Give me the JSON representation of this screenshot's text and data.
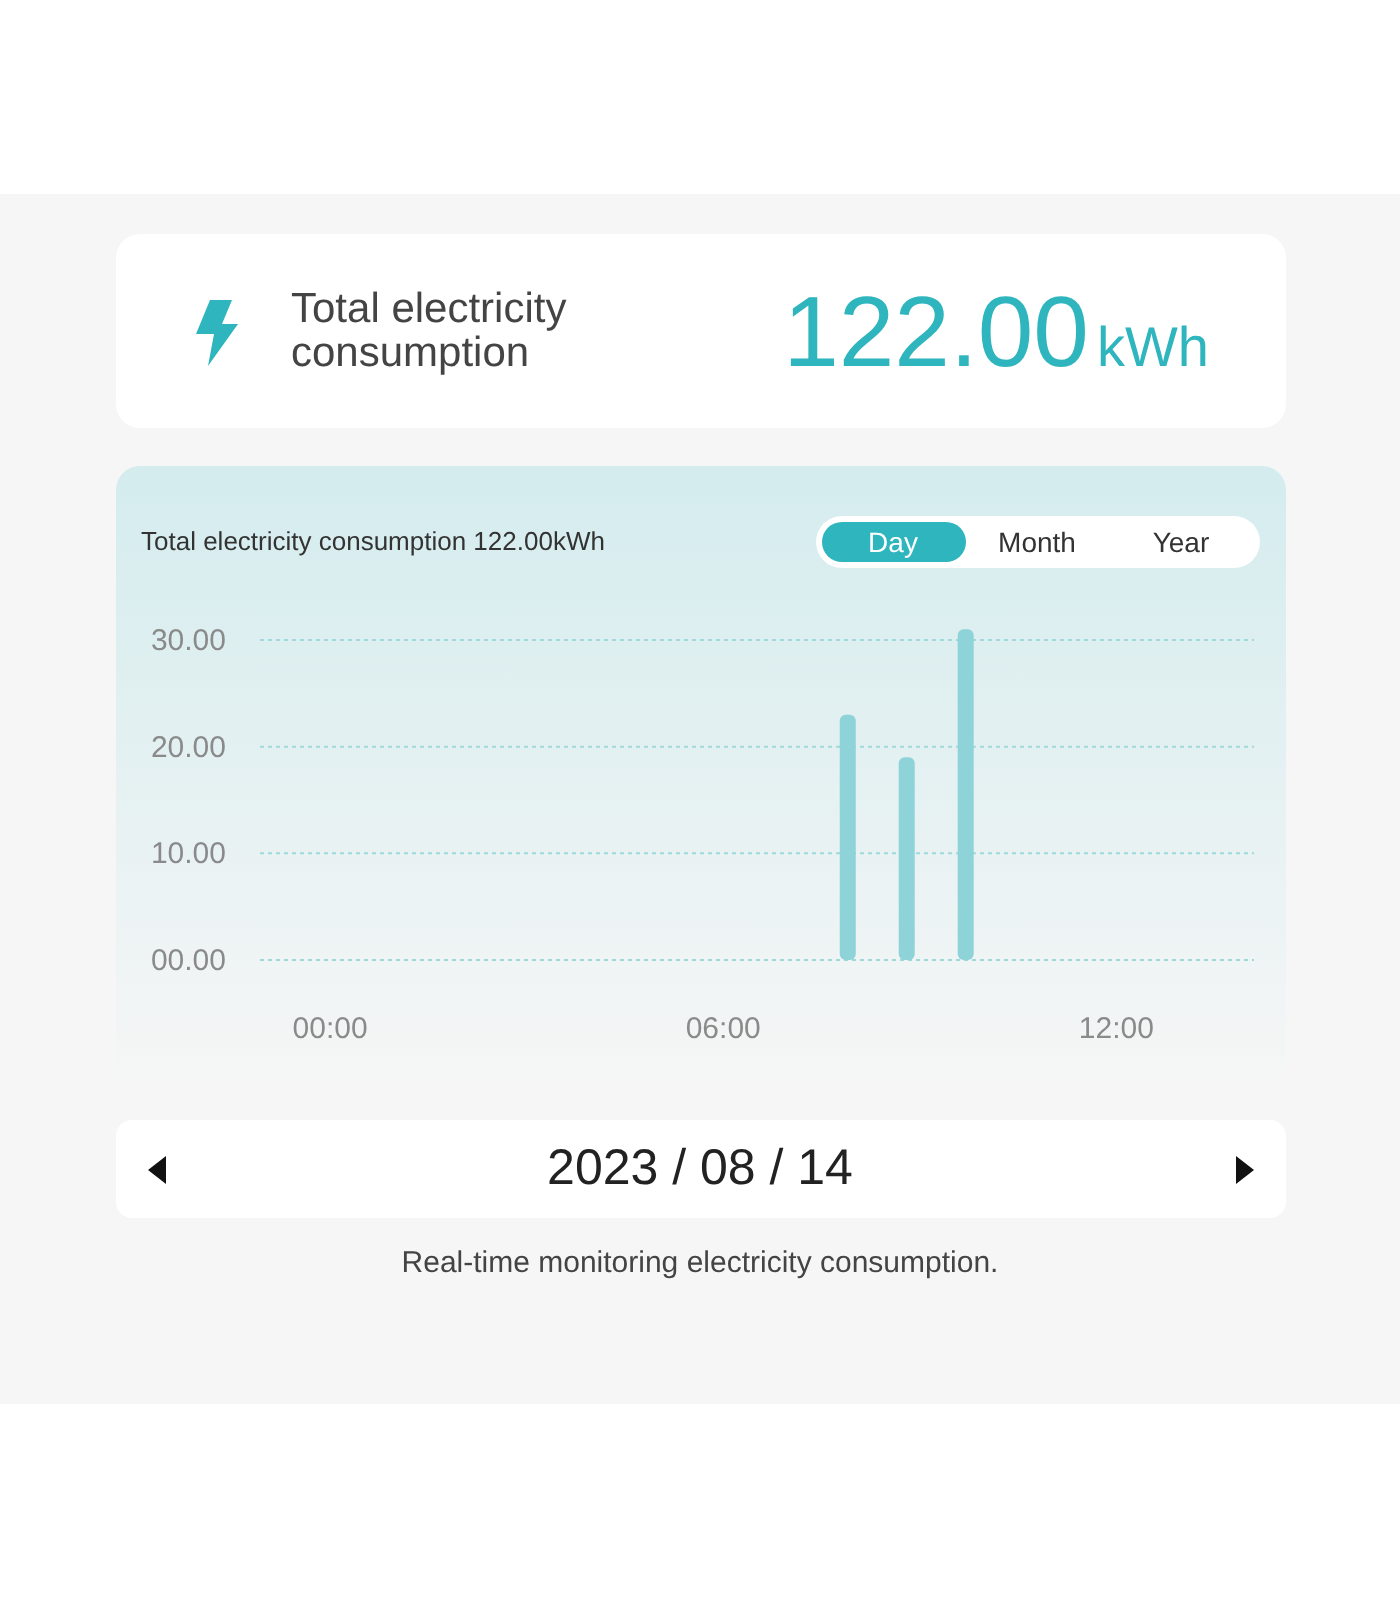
{
  "summary": {
    "label": "Total electricity consumption",
    "value": "122.00",
    "unit": "kWh"
  },
  "chart_panel": {
    "title": "Total electricity consumption 122.00kWh",
    "tabs": [
      {
        "label": "Day",
        "selected": true
      },
      {
        "label": "Month",
        "selected": false
      },
      {
        "label": "Year",
        "selected": false
      }
    ],
    "chart_data": {
      "type": "bar",
      "x": [
        7.9,
        8.8,
        9.7
      ],
      "series": [
        {
          "color": "#8dd3d7",
          "values": [
            23,
            19,
            31
          ]
        }
      ],
      "grid": true,
      "xlim": [
        -1.07,
        14.1
      ],
      "ylim": [
        0,
        31.5
      ],
      "xticks": [
        {
          "value": 0,
          "label": "00:00"
        },
        {
          "value": 6,
          "label": "06:00"
        },
        {
          "value": 12,
          "label": "12:00"
        }
      ],
      "yticks": [
        {
          "value": 0,
          "label": "00.00"
        },
        {
          "value": 10,
          "label": "10.00"
        },
        {
          "value": 20,
          "label": "20.00"
        },
        {
          "value": 30,
          "label": "30.00"
        }
      ]
    }
  },
  "date_nav": {
    "date": "2023 / 08 / 14"
  },
  "caption": "Real-time monitoring electricity consumption."
}
